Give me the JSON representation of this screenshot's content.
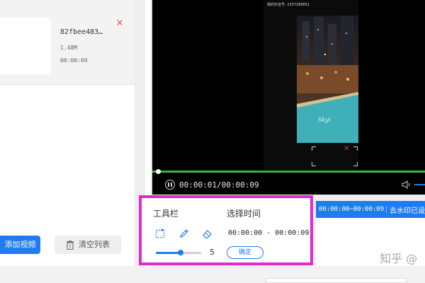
{
  "file": {
    "name": "82fbee483…",
    "size": "1.48M",
    "duration": "00:00:09",
    "remove_symbol": "×"
  },
  "actions": {
    "add_video": "添加视频",
    "clear_list": "清空列表"
  },
  "player": {
    "caption": "我的抖音号: 2337288851",
    "time": "00:00:01/00:00:09",
    "progress": 0.02,
    "crop_close_symbol": "×"
  },
  "toolbar": {
    "title": "工具栏",
    "select_time_title": "选择时间",
    "time_range": "00:00:00 - 00:00:09",
    "brush_size": "5",
    "brush_fraction": 0.55,
    "confirm_label": "确定"
  },
  "segment": {
    "time": "00:00:00~00:00:09",
    "status": "去水印已设"
  },
  "watermark": "知乎 @",
  "colors": {
    "accent": "#1f7cf0",
    "highlight_border": "#e02bcb",
    "progress": "#3ab53a",
    "close": "#e24a4a"
  }
}
